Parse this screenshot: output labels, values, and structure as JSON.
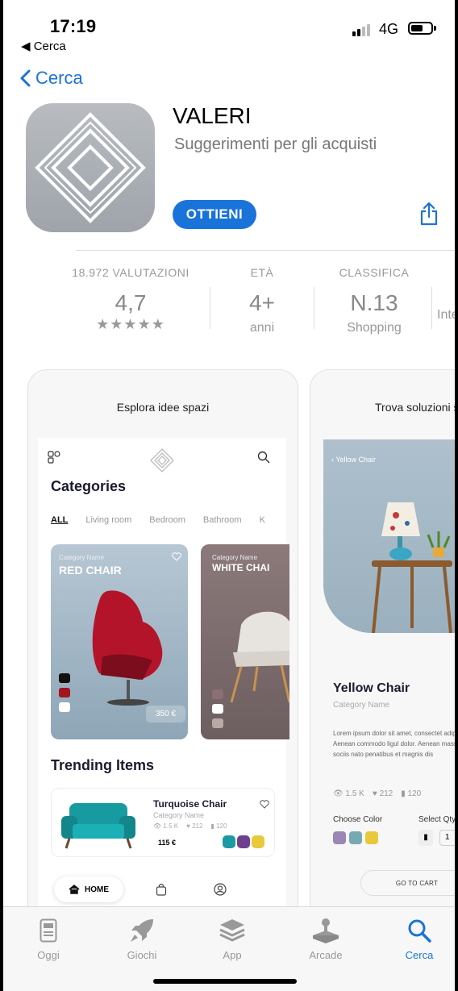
{
  "status_bar": {
    "time": "17:19",
    "back_label": "◀ Cerca",
    "network": "4G"
  },
  "nav": {
    "back_label": "Cerca"
  },
  "app": {
    "name": "VALERI",
    "subtitle": "Suggerimenti per gli acquisti",
    "get_label": "OTTIENI",
    "icon_name": "diamond-logo-icon"
  },
  "stats": [
    {
      "label": "18.972 VALUTAZIONI",
      "value": "4,7",
      "sub": "★★★★★"
    },
    {
      "label": "ETÀ",
      "value": "4+",
      "sub": "anni"
    },
    {
      "label": "CLASSIFICA",
      "value": "N.13",
      "sub": "Shopping"
    },
    {
      "label": "",
      "value": "",
      "sub": "Inte"
    }
  ],
  "screenshot1": {
    "caption": "Esplora idee spazi",
    "categories_title": "Categories",
    "tabs": [
      "ALL",
      "Living room",
      "Bedroom",
      "Bathroom",
      "K"
    ],
    "card_red": {
      "small": "Category Name",
      "title": "RED CHAIR",
      "price": "350 €",
      "swatches": [
        "#111111",
        "#a4141f",
        "#ffffff"
      ]
    },
    "card_white": {
      "small": "Category Name",
      "title": "WHITE CHAI",
      "swatches": [
        "#8a6f73",
        "#ffffff",
        "#b9a9a5"
      ]
    },
    "trending_title": "Trending Items",
    "trend_item": {
      "name": "Turquoise Chair",
      "category": "Category Name",
      "views": "1.5 K",
      "likes": "212",
      "bought": "120",
      "price": "115 €",
      "swatches": [
        "#1b9aa3",
        "#6e3f8f",
        "#e7c93b"
      ]
    },
    "home_label": "HOME"
  },
  "screenshot2": {
    "caption": "Trova soluzioni se",
    "back_label": "‹ Yellow Chair",
    "title": "Yellow Chair",
    "category": "Category Name",
    "lorem": "Lorem ipsum dolor sit amet, consectet adipiscing elit. Aenean commodo ligul dolor. Aenean massa. Cum sociis nato penatibus et magnis dis",
    "views": "1.5 K",
    "likes": "212",
    "bought": "120",
    "choose_color": "Choose Color",
    "select_qty": "Select Qty",
    "qty_value": "1",
    "go_to_cart": "GO TO CART",
    "swatches": [
      "#9b86b5",
      "#77a9b5",
      "#e7c93b"
    ]
  },
  "tabbar": [
    {
      "label": "Oggi",
      "icon": "today-icon",
      "active": false
    },
    {
      "label": "Giochi",
      "icon": "rocket-icon",
      "active": false
    },
    {
      "label": "App",
      "icon": "layers-icon",
      "active": false
    },
    {
      "label": "Arcade",
      "icon": "joystick-icon",
      "active": false
    },
    {
      "label": "Cerca",
      "icon": "search-icon",
      "active": true
    }
  ],
  "colors": {
    "accent": "#1a73d9",
    "gray_text": "#999999"
  }
}
